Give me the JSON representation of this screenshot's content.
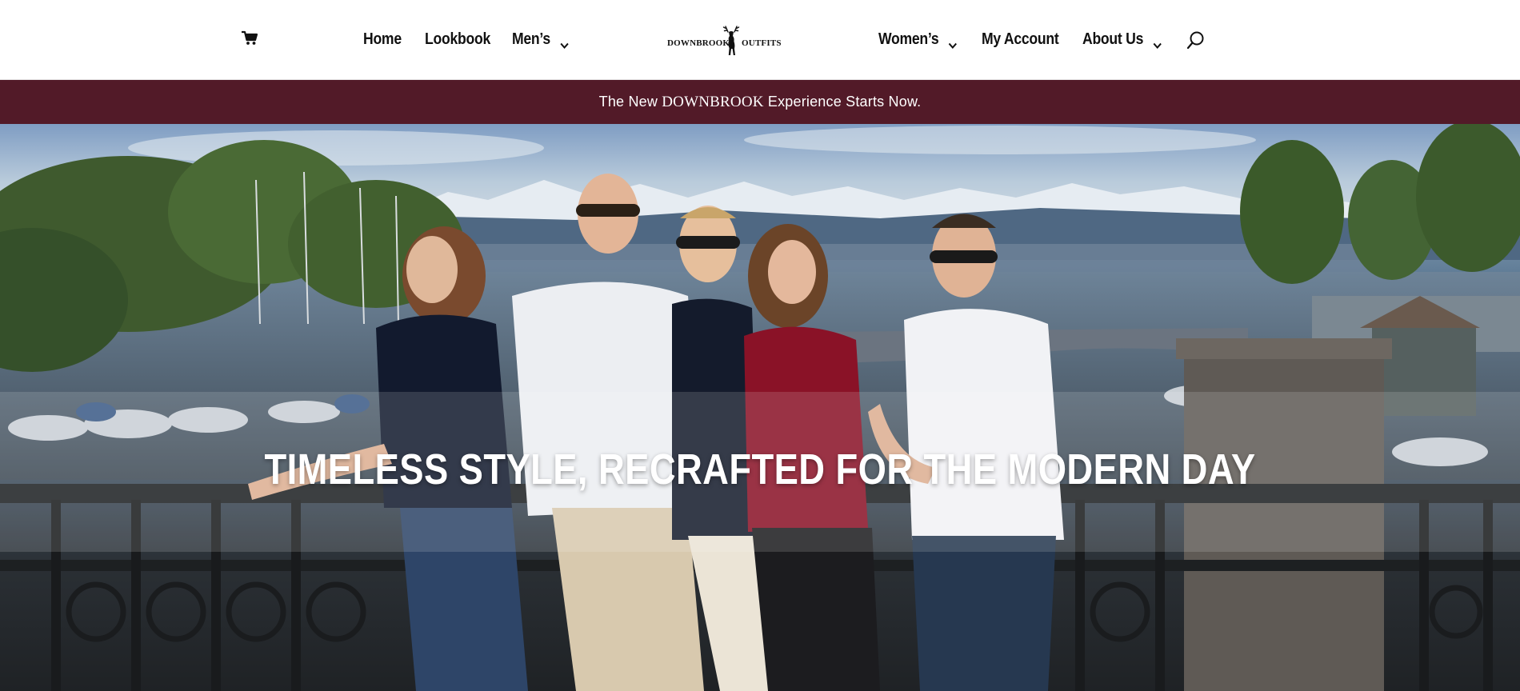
{
  "header": {
    "cart_icon": "cart-icon",
    "search_icon": "search-icon",
    "nav_left": [
      {
        "label": "Home",
        "dropdown": false
      },
      {
        "label": "Lookbook",
        "dropdown": false
      },
      {
        "label": "Men’s",
        "dropdown": true
      }
    ],
    "logo": {
      "left_text": "DOWNBROOK",
      "right_text": "OUTFITS",
      "icon": "stag-icon"
    },
    "nav_right": [
      {
        "label": "Women’s",
        "dropdown": true
      },
      {
        "label": "My Account",
        "dropdown": false
      },
      {
        "label": "About Us",
        "dropdown": true
      }
    ]
  },
  "announcement": {
    "prefix": "The New ",
    "brand": "DOWNBROOK",
    "suffix": " Experience Starts Now.",
    "background": "#521a28"
  },
  "hero": {
    "title": "TIMELESS STYLE, RECRAFTED FOR THE MODERN DAY"
  }
}
